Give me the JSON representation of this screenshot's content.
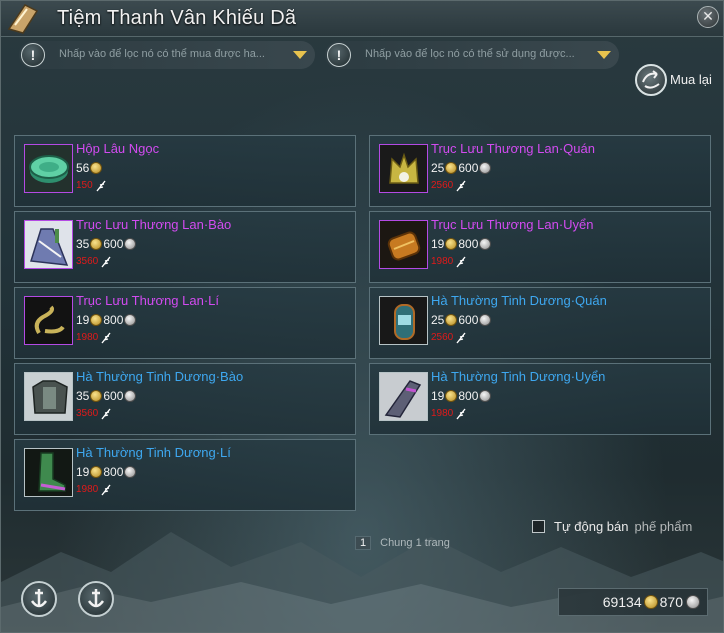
{
  "window": {
    "title": "Tiệm Thanh Vân Khiếu Dã"
  },
  "filters": [
    {
      "placeholder": "Nhấp vào để lọc nó có thể  mua được ha..."
    },
    {
      "placeholder": "Nhấp vào để lọc nó có thể sử dụng được..."
    }
  ],
  "buyback": {
    "label": "Mua lại"
  },
  "items": [
    {
      "name": "Hộp Lâu Ngọc",
      "rarity": "epic",
      "icon": "jade-box-icon",
      "gold": "56",
      "silver": "",
      "limit": "150"
    },
    {
      "name": "Trục Lưu Thương Lan·Quán",
      "rarity": "epic",
      "icon": "crown-icon",
      "gold": "25",
      "silver": "600",
      "limit": "2560"
    },
    {
      "name": "Trục Lưu Thương Lan·Bào",
      "rarity": "epic",
      "icon": "robe-icon",
      "gold": "35",
      "silver": "600",
      "limit": "3560"
    },
    {
      "name": "Trục Lưu Thương Lan·Uyển",
      "rarity": "epic",
      "icon": "bracer-icon",
      "gold": "19",
      "silver": "800",
      "limit": "1980"
    },
    {
      "name": "Trục Lưu Thương Lan·Lí",
      "rarity": "epic",
      "icon": "boots-icon",
      "gold": "19",
      "silver": "800",
      "limit": "1980"
    },
    {
      "name": "Hà Thường Tinh Dương·Quán",
      "rarity": "rare",
      "icon": "helm-icon",
      "gold": "25",
      "silver": "600",
      "limit": "2560"
    },
    {
      "name": "Hà Thường Tinh Dương·Bào",
      "rarity": "rare",
      "icon": "armor-icon",
      "gold": "35",
      "silver": "600",
      "limit": "3560"
    },
    {
      "name": "Hà Thường Tinh Dương·Uyển",
      "rarity": "rare",
      "icon": "gauntlet-icon",
      "gold": "19",
      "silver": "800",
      "limit": "1980"
    },
    {
      "name": "Hà Thường Tinh Dương·Lí",
      "rarity": "rare",
      "icon": "boot-icon",
      "gold": "19",
      "silver": "800",
      "limit": "1980"
    }
  ],
  "auto_sell": {
    "label": "Tự động bán",
    "suffix": "phế phẩm"
  },
  "pager": {
    "page": "1",
    "total_text": "Chung 1 trang"
  },
  "currency": {
    "gold": "69134",
    "silver": "870"
  },
  "colors": {
    "epic": "#d24bf0",
    "rare": "#3ea8f0",
    "limit": "#e01a1a",
    "accent": "#e8c34e"
  }
}
